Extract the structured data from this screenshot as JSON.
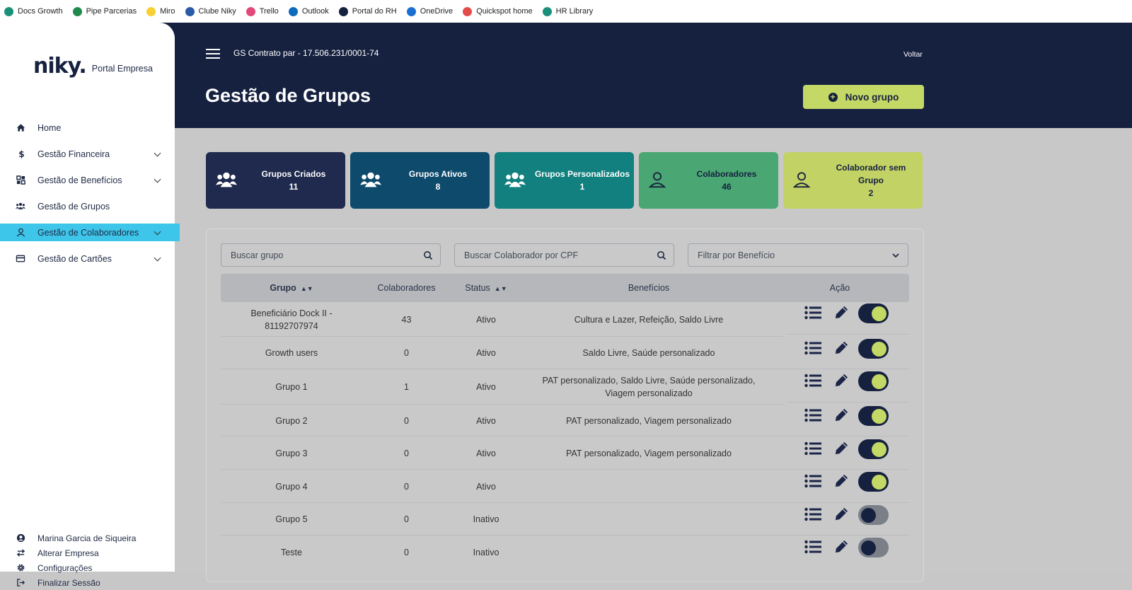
{
  "bookmarks": [
    {
      "label": "Docs Growth",
      "icon": "docs-growth-icon",
      "color": "#1a8f7a"
    },
    {
      "label": "Pipe Parcerias",
      "icon": "pipe-icon",
      "color": "#1f8a4c"
    },
    {
      "label": "Miro",
      "icon": "miro-icon",
      "color": "#f7d131"
    },
    {
      "label": "Clube Niky",
      "icon": "clube-niky-icon",
      "color": "#2a5aa8"
    },
    {
      "label": "Trello",
      "icon": "trello-icon",
      "color": "#e0497a"
    },
    {
      "label": "Outlook",
      "icon": "outlook-icon",
      "color": "#0f6cbd"
    },
    {
      "label": "Portal do RH",
      "icon": "portal-rh-icon",
      "color": "#162140"
    },
    {
      "label": "OneDrive",
      "icon": "onedrive-icon",
      "color": "#1b6fd1"
    },
    {
      "label": "Quickspot home",
      "icon": "quickspot-icon",
      "color": "#e44b4b"
    },
    {
      "label": "HR Library",
      "icon": "hr-library-icon",
      "color": "#1a8f7a"
    }
  ],
  "sidebar": {
    "brand": "niky.",
    "portal": "Portal Empresa",
    "items": [
      {
        "label": "Home",
        "icon": "home-icon",
        "chevron": false,
        "active": false
      },
      {
        "label": "Gestão Financeira",
        "icon": "dollar-icon",
        "chevron": true,
        "active": false
      },
      {
        "label": "Gestão de Benefícios",
        "icon": "grid-icon",
        "chevron": true,
        "active": false
      },
      {
        "label": "Gestão de Grupos",
        "icon": "users-icon",
        "chevron": false,
        "active": false
      },
      {
        "label": "Gestão de Colaboradores",
        "icon": "user-icon",
        "chevron": true,
        "active": true
      },
      {
        "label": "Gestão de Cartões",
        "icon": "card-icon",
        "chevron": true,
        "active": false
      }
    ],
    "footer": [
      {
        "label": "Marina Garcia de Siqueira",
        "icon": "user-circle-icon"
      },
      {
        "label": "Alterar Empresa",
        "icon": "swap-icon"
      },
      {
        "label": "Configurações",
        "icon": "gear-icon"
      },
      {
        "label": "Finalizar Sessão",
        "icon": "logout-icon"
      }
    ]
  },
  "header": {
    "company": "GS Contrato par  -  17.506.231/0001-74",
    "back": "Voltar",
    "title": "Gestão de Grupos",
    "new_group": "Novo grupo"
  },
  "cards": [
    {
      "label": "Grupos Criados",
      "value": "11",
      "color": "#1f2a4e",
      "text_color": "#ffffff",
      "icon": "users-icon"
    },
    {
      "label": "Grupos Ativos",
      "value": "8",
      "color": "#0d4a6c",
      "text_color": "#ffffff",
      "icon": "users-icon"
    },
    {
      "label": "Grupos Personalizados",
      "value": "1",
      "color": "#11807f",
      "text_color": "#ffffff",
      "icon": "users-icon"
    },
    {
      "label": "Colaboradores",
      "value": "46",
      "color": "#4aa672",
      "text_color": "#162140",
      "icon": "user-icon"
    },
    {
      "label": "Colaborador sem Grupo",
      "value": "2",
      "color": "#c2d265",
      "text_color": "#162140",
      "icon": "user-icon"
    }
  ],
  "filters": {
    "search_group": "Buscar grupo",
    "search_cpf": "Buscar Colaborador por CPF",
    "benefit_filter": "Filtrar por Benefício"
  },
  "table": {
    "headers": {
      "group": "Grupo",
      "collaborators": "Colaboradores",
      "status": "Status",
      "benefits": "Benefícios",
      "action": "Ação"
    },
    "rows": [
      {
        "group": "Beneficiário Dock II - 81192707974",
        "collaborators": "43",
        "status": "Ativo",
        "benefits": "Cultura e Lazer, Refeição, Saldo Livre",
        "on": true
      },
      {
        "group": "Growth users",
        "collaborators": "0",
        "status": "Ativo",
        "benefits": "Saldo Livre, Saúde personalizado",
        "on": true
      },
      {
        "group": "Grupo 1",
        "collaborators": "1",
        "status": "Ativo",
        "benefits": "PAT personalizado, Saldo Livre, Saúde personalizado, Viagem personalizado",
        "on": true
      },
      {
        "group": "Grupo 2",
        "collaborators": "0",
        "status": "Ativo",
        "benefits": "PAT personalizado, Viagem personalizado",
        "on": true
      },
      {
        "group": "Grupo 3",
        "collaborators": "0",
        "status": "Ativo",
        "benefits": "PAT personalizado, Viagem personalizado",
        "on": true
      },
      {
        "group": "Grupo 4",
        "collaborators": "0",
        "status": "Ativo",
        "benefits": "",
        "on": true
      },
      {
        "group": "Grupo 5",
        "collaborators": "0",
        "status": "Inativo",
        "benefits": "",
        "on": false
      },
      {
        "group": "Teste",
        "collaborators": "0",
        "status": "Inativo",
        "benefits": "",
        "on": false
      }
    ]
  },
  "colors": {
    "navy": "#162140",
    "accent": "#c4d865",
    "highlight": "#3ec5ea",
    "toggle_off": "#7a7f88"
  }
}
